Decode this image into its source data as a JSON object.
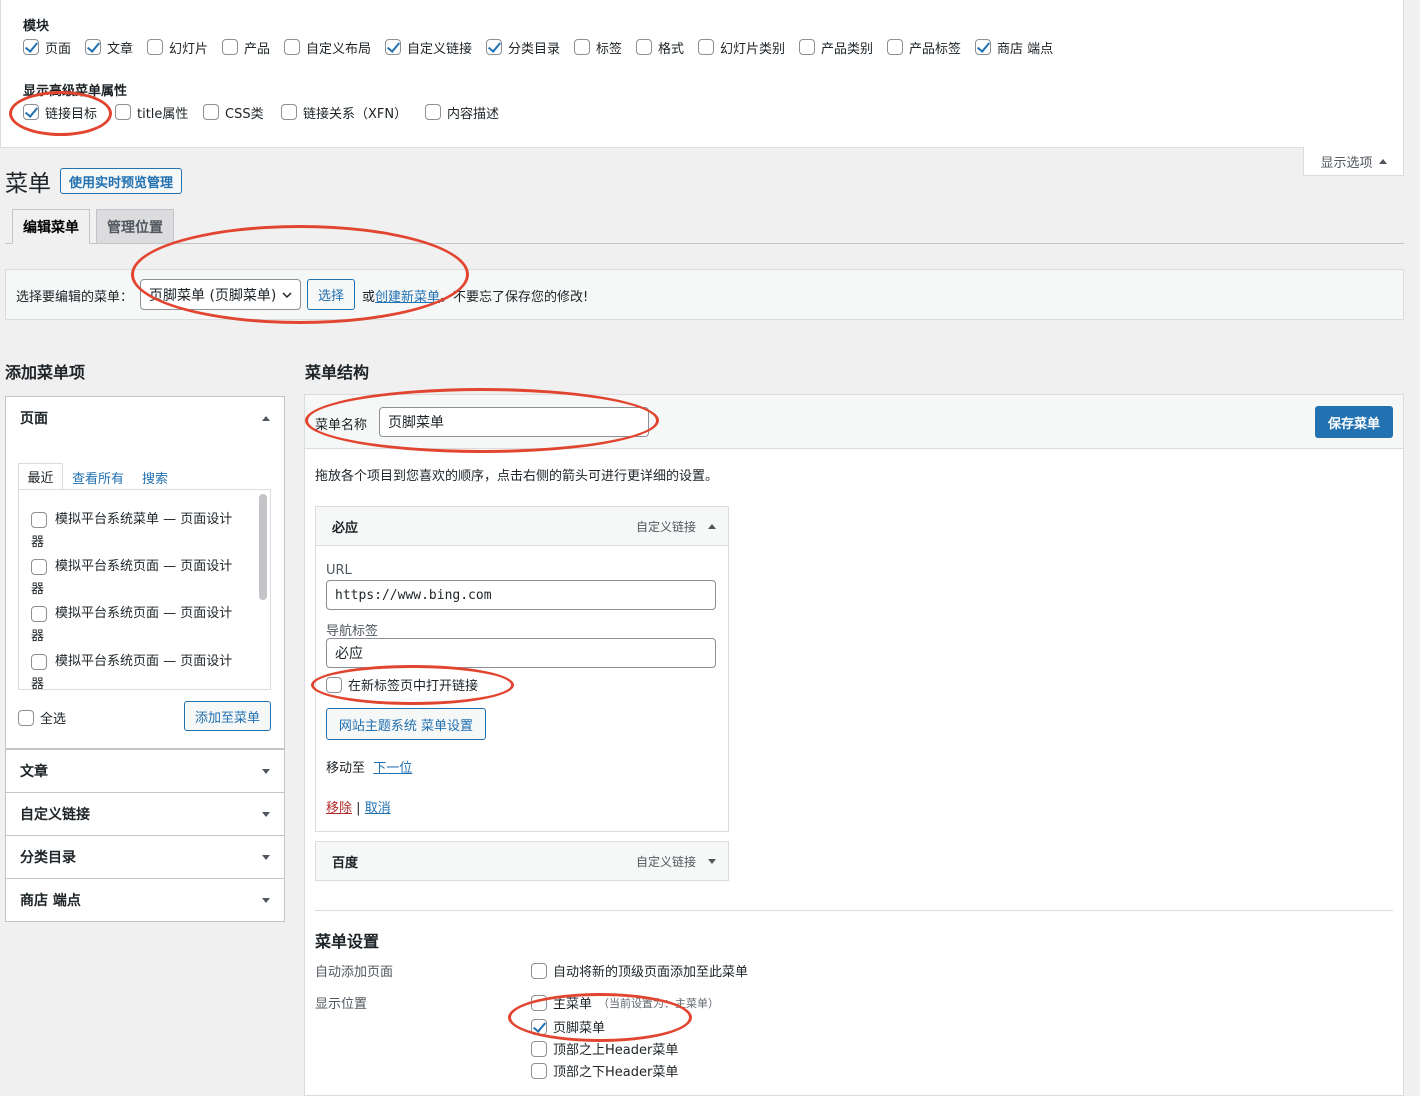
{
  "screen_options": {
    "modules_heading": "模块",
    "modules": [
      {
        "label": "页面",
        "checked": true
      },
      {
        "label": "文章",
        "checked": true
      },
      {
        "label": "幻灯片",
        "checked": false
      },
      {
        "label": "产品",
        "checked": false
      },
      {
        "label": "自定义布局",
        "checked": false
      },
      {
        "label": "自定义链接",
        "checked": true
      },
      {
        "label": "分类目录",
        "checked": true
      },
      {
        "label": "标签",
        "checked": false
      },
      {
        "label": "格式",
        "checked": false
      },
      {
        "label": "幻灯片类别",
        "checked": false
      },
      {
        "label": "产品类别",
        "checked": false
      },
      {
        "label": "产品标签",
        "checked": false
      },
      {
        "label": "商店 端点",
        "checked": true
      }
    ],
    "advanced_heading": "显示高级菜单属性",
    "advanced": [
      {
        "label": "链接目标",
        "checked": true
      },
      {
        "label": "title属性",
        "checked": false
      },
      {
        "label": "CSS类",
        "checked": false
      },
      {
        "label": "链接关系（XFN）",
        "checked": false
      },
      {
        "label": "内容描述",
        "checked": false
      }
    ],
    "toggle_label": "显示选项"
  },
  "header": {
    "title": "菜单",
    "live_preview": "使用实时预览管理"
  },
  "tabs": [
    {
      "label": "编辑菜单"
    },
    {
      "label": "管理位置"
    }
  ],
  "select_bar": {
    "label": "选择要编辑的菜单：",
    "selected": "页脚菜单 (页脚菜单)",
    "select_button": "选择",
    "or": "或",
    "create_link": "创建新菜单",
    "reminder": "。不要忘了保存您的修改!"
  },
  "left": {
    "heading": "添加菜单项",
    "pages_title": "页面",
    "subtabs": [
      "最近",
      "查看所有",
      "搜索"
    ],
    "pages": [
      {
        "line1": "模拟平台系统菜单 — 页面设计",
        "line2": "器"
      },
      {
        "line1": "模拟平台系统页面 — 页面设计",
        "line2": "器"
      },
      {
        "line1": "模拟平台系统页面 — 页面设计",
        "line2": "器"
      },
      {
        "line1": "模拟平台系统页面 — 页面设计",
        "line2": "器"
      }
    ],
    "select_all": "全选",
    "add_button": "添加至菜单",
    "sections": [
      "文章",
      "自定义链接",
      "分类目录",
      "商店 端点"
    ]
  },
  "right": {
    "heading": "菜单结构",
    "name_label": "菜单名称",
    "name_value": "页脚菜单",
    "save_button": "保存菜单",
    "instructions": "拖放各个项目到您喜欢的顺序，点击右侧的箭头可进行更详细的设置。",
    "items": [
      {
        "title": "必应",
        "type": "自定义链接",
        "url_label": "URL",
        "url_value": "https://www.bing.com",
        "nav_label": "导航标签",
        "nav_value": "必应",
        "newtab_label": "在新标签页中打开链接",
        "theme_button": "网站主题系统 菜单设置",
        "move_label": "移动至",
        "move_link": "下一位",
        "remove": "移除",
        "sep": "|",
        "cancel": "取消"
      },
      {
        "title": "百度",
        "type": "自定义链接"
      }
    ],
    "settings": {
      "heading": "菜单设置",
      "auto_add_label": "自动添加页面",
      "auto_add_option": "自动将新的顶级页面添加至此菜单",
      "display_label": "显示位置",
      "locations": [
        {
          "label": "主菜单",
          "note": "（当前设置为：主菜单）",
          "checked": false
        },
        {
          "label": "页脚菜单",
          "note": "",
          "checked": true
        },
        {
          "label": "顶部之上Header菜单",
          "note": "",
          "checked": false
        },
        {
          "label": "顶部之下Header菜单",
          "note": "",
          "checked": false
        }
      ]
    }
  }
}
